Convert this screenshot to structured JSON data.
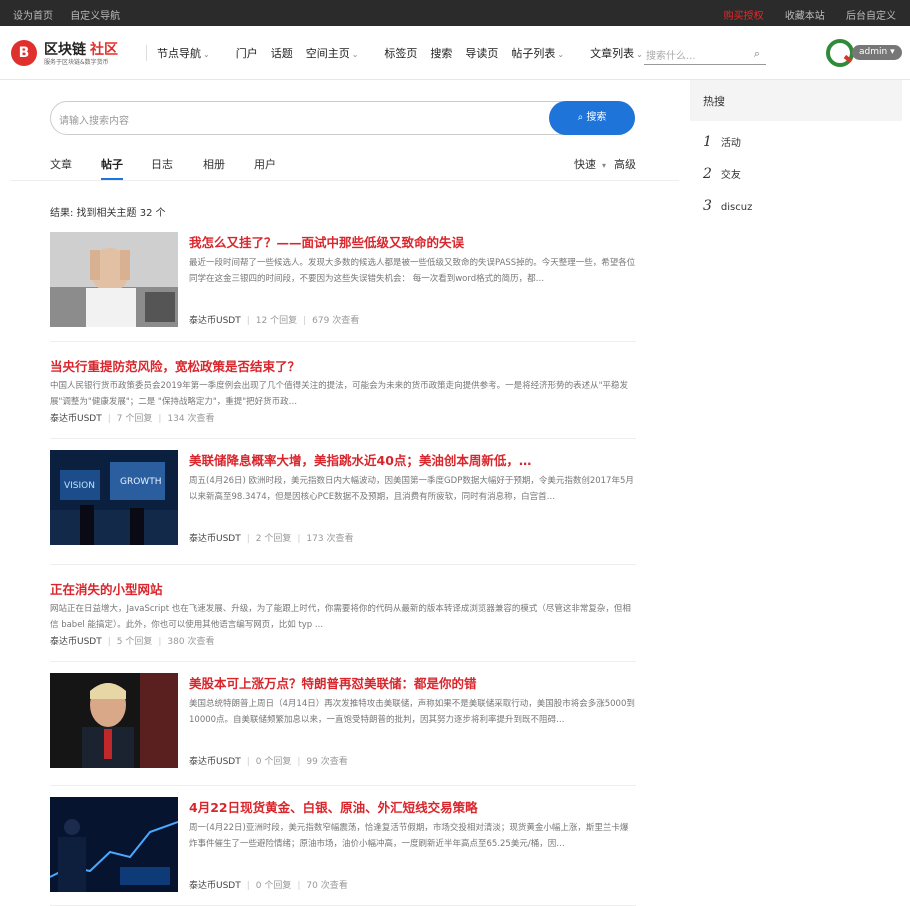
{
  "topbar": {
    "left": [
      "设为首页",
      "自定义导航"
    ],
    "right": [
      "购买授权",
      "收藏本站",
      "后台自定义"
    ]
  },
  "header": {
    "logo_glyph": "B",
    "logo_name": "区块链",
    "logo_community": "社区",
    "logo_slogan": "服务于区块链&数字货币",
    "nav": [
      {
        "label": "节点导航",
        "dropdown": true,
        "color": "default"
      },
      {
        "label": "门户",
        "dropdown": false,
        "color": "default"
      },
      {
        "label": "话题",
        "dropdown": false,
        "color": "default"
      },
      {
        "label": "空间主页",
        "dropdown": true,
        "color": "#e0302e"
      },
      {
        "label": "标签页",
        "dropdown": false,
        "color": "default"
      },
      {
        "label": "搜索",
        "dropdown": false,
        "color": "default"
      },
      {
        "label": "导读页",
        "dropdown": false,
        "color": "default"
      },
      {
        "label": "帖子列表",
        "dropdown": true,
        "color": "#8a3c96"
      },
      {
        "label": "文章列表",
        "dropdown": true,
        "color": "#2f8a3a"
      }
    ],
    "search_placeholder": "搜索什么...",
    "search_icon": "search-icon",
    "username": "admin",
    "user_chevron": "▾"
  },
  "search": {
    "placeholder": "请输入搜索内容",
    "button_icon": "search-icon",
    "button_label": "搜索"
  },
  "tabs": [
    "文章",
    "帖子",
    "日志",
    "相册",
    "用户"
  ],
  "active_tab": "帖子",
  "tab_options": {
    "sort": "快速",
    "advanced": "高级"
  },
  "result_text": "结果: 找到相关主题 32 个",
  "posts": [
    {
      "title": "我怎么又挂了？——面试中那些低级又致命的失误",
      "desc": "最近一段时间帮了一些候选人。发现大多数的候选人都是被一些低级又致命的失误PASS掉的。今天整理一些，希望各位同学在这金三银四的时间段，不要因为这些失误错失机会： 每一次看到word格式的简历，都…",
      "author": "泰达币USDT",
      "replies": "12 个回复",
      "views": "679 次查看",
      "has_thumb": true
    },
    {
      "title": "当央行重提防范风险，宽松政策是否结束了？",
      "desc": "中国人民银行货币政策委员会2019年第一季度例会出现了几个值得关注的提法，可能会为未来的货币政策走向提供参考。一是将经济形势的表述从\"平稳发展\"调整为\"健康发展\"；二是 \"保持战略定力\"，重提\"把好货币政…",
      "author": "泰达币USDT",
      "replies": "7 个回复",
      "views": "134 次查看",
      "has_thumb": false
    },
    {
      "title": "美联储降息概率大增，美指跳水近40点；美油创本周新低，…",
      "desc": "周五(4月26日) 欧洲时段，美元指数日内大幅波动，因美国第一季度GDP数据大幅好于预期，令美元指数创2017年5月以来新高至98.3474，但是因核心PCE数据不及预期，且消费有所疲软，同时有消息称，白宫首…",
      "author": "泰达币USDT",
      "replies": "2 个回复",
      "views": "173 次查看",
      "has_thumb": true
    },
    {
      "title": "正在消失的小型网站",
      "desc": "网站正在日益增大，JavaScript 也在飞速发展、升级，为了能跟上时代，你需要将你的代码从最新的版本转译成浏览器兼容的模式（尽管这非常复杂，但相信 babel 能搞定）。此外，你也可以使用其他语言编写网页，比如 typ ...",
      "author": "泰达币USDT",
      "replies": "5 个回复",
      "views": "380 次查看",
      "has_thumb": false
    },
    {
      "title": "美股本可上涨万点？特朗普再怼美联储：都是你的错",
      "desc": "美国总统特朗普上周日（4月14日）再次发推特攻击美联储，声称如果不是美联储采取行动，美国股市将会多涨5000到10000点。自美联储频繁加息以来，一直饱受特朗普的批判，因其努力逐步将利率提升到既不阻碍…",
      "author": "泰达币USDT",
      "replies": "0 个回复",
      "views": "99 次查看",
      "has_thumb": true
    },
    {
      "title": "4月22日现货黄金、白银、原油、外汇短线交易策略",
      "desc": "周一(4月22日)亚洲时段，美元指数窄幅震荡，恰逢复活节假期，市场交投相对清淡；现货黄金小幅上涨，斯里兰卡爆炸事件催生了一些避险情绪；原油市场，油价小幅冲高，一度刷新近半年高点至65.25美元/桶，因…",
      "author": "泰达币USDT",
      "replies": "0 个回复",
      "views": "70 次查看",
      "has_thumb": true
    }
  ],
  "sidebar": {
    "title": "热搜",
    "items": [
      {
        "rank": "1",
        "label": "活动"
      },
      {
        "rank": "2",
        "label": "交友"
      },
      {
        "rank": "3",
        "label": "discuz"
      }
    ]
  },
  "colors": {
    "accent_red": "#d9262c",
    "accent_blue": "#1e74d8",
    "topbar_bg": "#2b2b2b"
  }
}
